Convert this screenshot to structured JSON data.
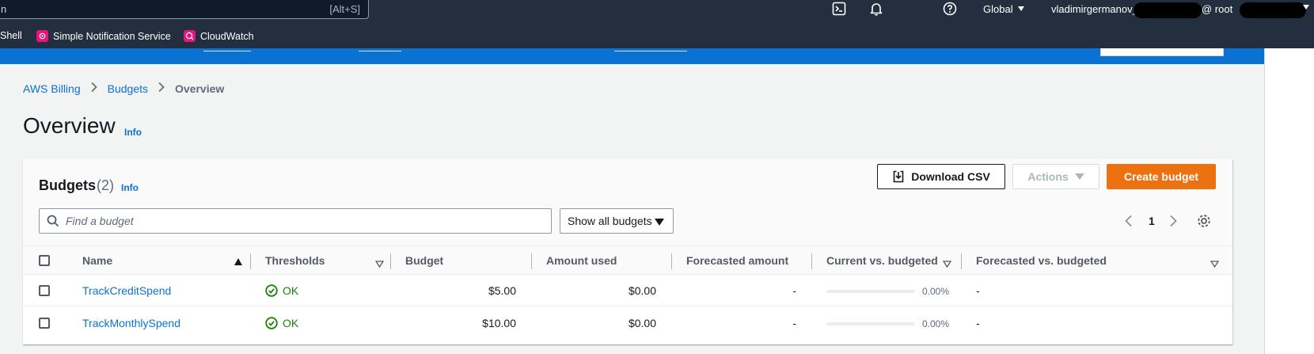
{
  "topnav": {
    "search_partial_char": "n",
    "search_shortcut": "[Alt+S]",
    "region": "Global",
    "username": "vladimirgermanov_",
    "account_prefix": "@ root"
  },
  "services_bar": {
    "items": [
      {
        "label": "Shell"
      },
      {
        "label": "Simple Notification Service"
      },
      {
        "label": "CloudWatch"
      }
    ]
  },
  "breadcrumb": {
    "items": [
      "AWS Billing",
      "Budgets"
    ],
    "current": "Overview"
  },
  "page": {
    "title": "Overview",
    "info": "Info"
  },
  "budgets": {
    "title": "Budgets",
    "count": "(2)",
    "info": "Info",
    "download_label": "Download CSV",
    "actions_label": "Actions",
    "create_label": "Create budget",
    "search_placeholder": "Find a budget",
    "filter_selected": "Show all budgets",
    "page_number": "1",
    "columns": [
      "Name",
      "Thresholds",
      "Budget",
      "Amount used",
      "Forecasted amount",
      "Current vs. budgeted",
      "Forecasted vs. budgeted"
    ],
    "rows": [
      {
        "name": "TrackCreditSpend",
        "threshold": "OK",
        "budget": "$5.00",
        "amount_used": "$0.00",
        "forecasted": "-",
        "current_pct": "0.00%",
        "current_fraction": 0,
        "forecasted_vs": "-"
      },
      {
        "name": "TrackMonthlySpend",
        "threshold": "OK",
        "budget": "$10.00",
        "amount_used": "$0.00",
        "forecasted": "-",
        "current_pct": "0.00%",
        "current_fraction": 0,
        "forecasted_vs": "-"
      }
    ]
  },
  "colors": {
    "nav_bg": "#232f3e",
    "link": "#0972d3",
    "primary_button": "#ec7211",
    "ok_green": "#1d8102"
  }
}
